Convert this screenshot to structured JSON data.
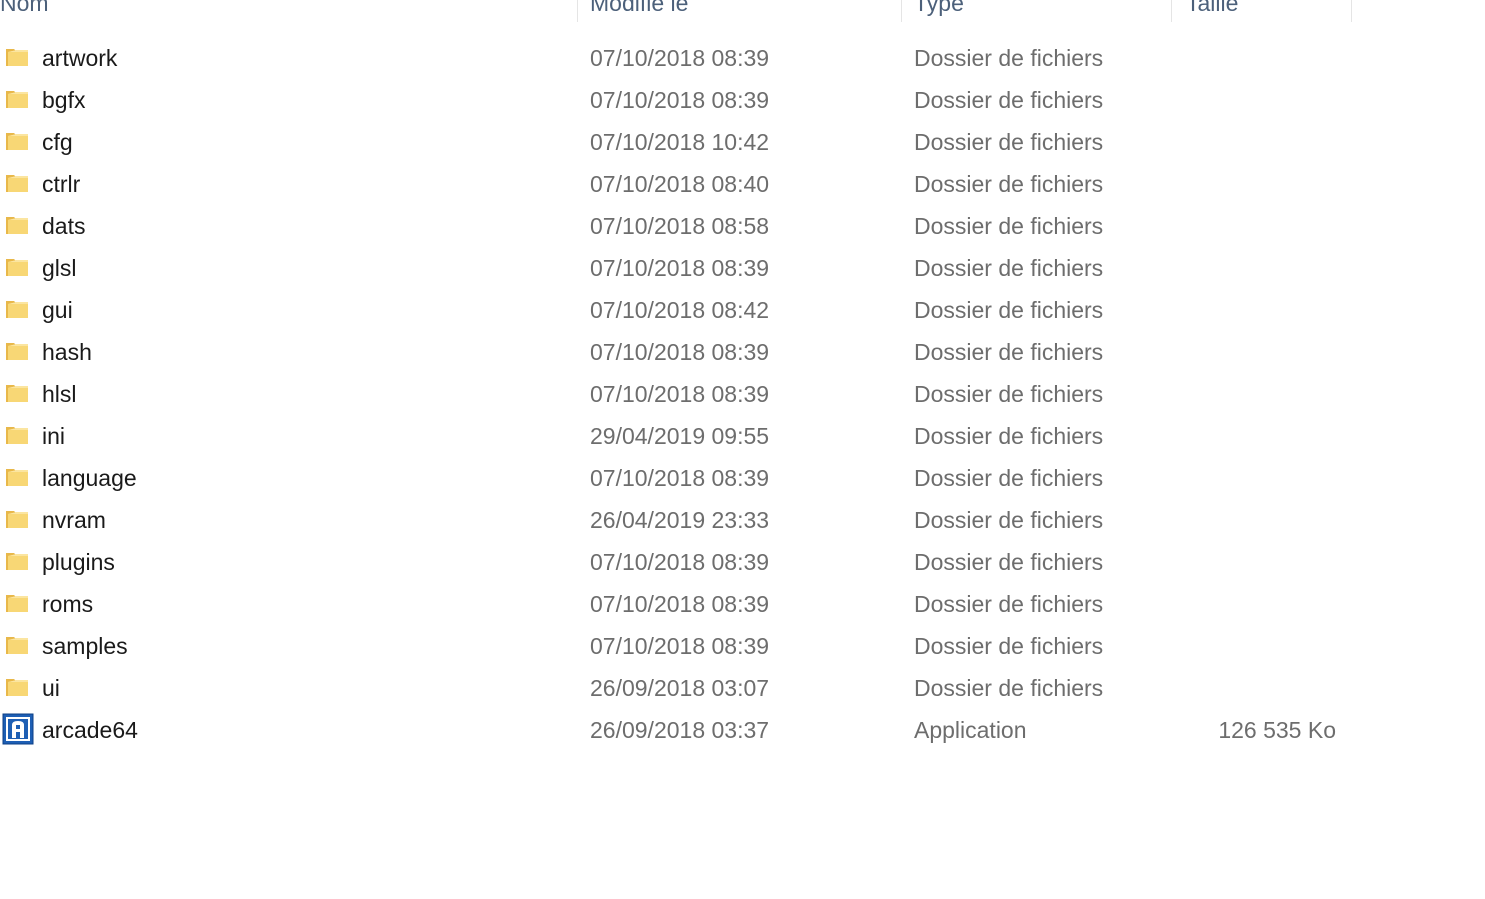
{
  "columns": {
    "name": "Nom",
    "date": "Modifié le",
    "type": "Type",
    "size": "Taille"
  },
  "files": [
    {
      "name": "artwork",
      "date": "07/10/2018 08:39",
      "type": "Dossier de fichiers",
      "size": "",
      "icon": "folder-icon"
    },
    {
      "name": "bgfx",
      "date": "07/10/2018 08:39",
      "type": "Dossier de fichiers",
      "size": "",
      "icon": "folder-icon"
    },
    {
      "name": "cfg",
      "date": "07/10/2018 10:42",
      "type": "Dossier de fichiers",
      "size": "",
      "icon": "folder-icon"
    },
    {
      "name": "ctrlr",
      "date": "07/10/2018 08:40",
      "type": "Dossier de fichiers",
      "size": "",
      "icon": "folder-icon"
    },
    {
      "name": "dats",
      "date": "07/10/2018 08:58",
      "type": "Dossier de fichiers",
      "size": "",
      "icon": "folder-icon"
    },
    {
      "name": "glsl",
      "date": "07/10/2018 08:39",
      "type": "Dossier de fichiers",
      "size": "",
      "icon": "folder-icon"
    },
    {
      "name": "gui",
      "date": "07/10/2018 08:42",
      "type": "Dossier de fichiers",
      "size": "",
      "icon": "folder-icon"
    },
    {
      "name": "hash",
      "date": "07/10/2018 08:39",
      "type": "Dossier de fichiers",
      "size": "",
      "icon": "folder-icon"
    },
    {
      "name": "hlsl",
      "date": "07/10/2018 08:39",
      "type": "Dossier de fichiers",
      "size": "",
      "icon": "folder-icon"
    },
    {
      "name": "ini",
      "date": "29/04/2019 09:55",
      "type": "Dossier de fichiers",
      "size": "",
      "icon": "folder-icon"
    },
    {
      "name": "language",
      "date": "07/10/2018 08:39",
      "type": "Dossier de fichiers",
      "size": "",
      "icon": "folder-icon"
    },
    {
      "name": "nvram",
      "date": "26/04/2019 23:33",
      "type": "Dossier de fichiers",
      "size": "",
      "icon": "folder-icon"
    },
    {
      "name": "plugins",
      "date": "07/10/2018 08:39",
      "type": "Dossier de fichiers",
      "size": "",
      "icon": "folder-icon"
    },
    {
      "name": "roms",
      "date": "07/10/2018 08:39",
      "type": "Dossier de fichiers",
      "size": "",
      "icon": "folder-icon"
    },
    {
      "name": "samples",
      "date": "07/10/2018 08:39",
      "type": "Dossier de fichiers",
      "size": "",
      "icon": "folder-icon"
    },
    {
      "name": "ui",
      "date": "26/09/2018 03:07",
      "type": "Dossier de fichiers",
      "size": "",
      "icon": "folder-icon"
    },
    {
      "name": "arcade64",
      "date": "26/09/2018 03:37",
      "type": "Application",
      "size": "126 535 Ko",
      "icon": "arcade-app-icon"
    }
  ],
  "colors": {
    "folder": "#f8d775",
    "folder_dark": "#e8b84a",
    "app_blue": "#1e5fb4"
  }
}
